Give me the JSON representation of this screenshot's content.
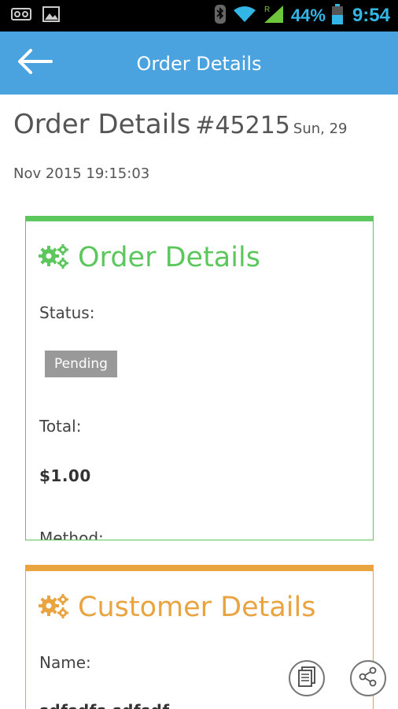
{
  "status_bar": {
    "battery_percent": "44%",
    "time": "9:54",
    "icons": [
      "voicemail-icon",
      "image-icon",
      "bluetooth-icon",
      "wifi-icon",
      "signal-icon",
      "battery-icon"
    ]
  },
  "app_bar": {
    "title": "Order Details",
    "back_icon": "arrow-left-icon"
  },
  "header": {
    "title": "Order Details",
    "order_number": "#45215",
    "date_line1": "Sun, 29",
    "date_line2": "Nov 2015 19:15:03"
  },
  "order_card": {
    "title": "Order Details",
    "icon": "gears-icon",
    "status_label": "Status:",
    "status_value": "Pending",
    "total_label": "Total:",
    "total_value": "$1.00",
    "method_label": "Method:"
  },
  "customer_card": {
    "title": "Customer Details",
    "icon": "gears-icon",
    "name_label": "Name:",
    "name_value": "sdfsdfs sdfsdf"
  },
  "actions": {
    "document_icon": "document-icon",
    "share_icon": "share-icon"
  },
  "colors": {
    "app_bar": "#4aa3df",
    "order_accent": "#5cc75c",
    "customer_accent": "#e9a440",
    "status_bar_text": "#33b5e5",
    "badge": "#999999"
  }
}
